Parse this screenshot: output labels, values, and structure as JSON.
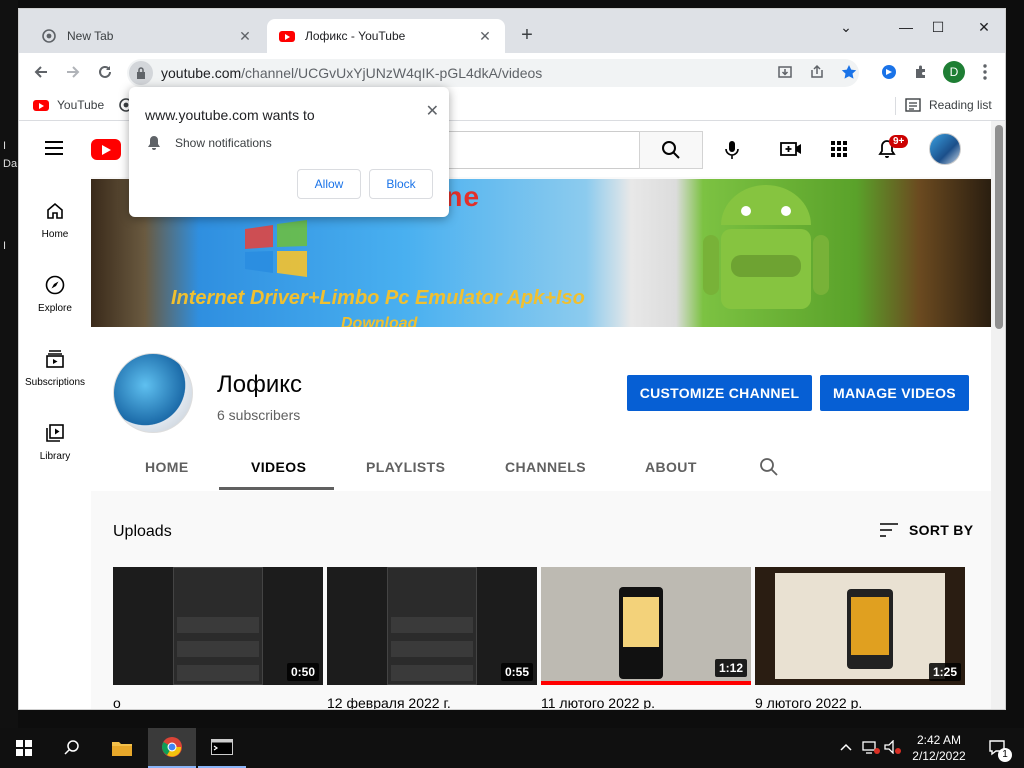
{
  "desktop": {
    "left_label_1": "I",
    "left_label_2": "Da",
    "left_label_3": "I"
  },
  "browser": {
    "tabs": [
      {
        "title": "New Tab",
        "close": "✕"
      },
      {
        "title": "Лофикс - YouTube",
        "close": "✕"
      }
    ],
    "new_tab": "+",
    "window_controls": {
      "tab_search": "⌄",
      "minimize": "—",
      "maximize": "☐",
      "close": "✕"
    },
    "url_host": "youtube.com",
    "url_path": "/channel/UCGvUxYjUNzW4qIK-pGL4dkA/videos",
    "profile_initial": "D",
    "bookmarks": [
      {
        "label": "YouTube"
      }
    ],
    "reading_list": "Reading list"
  },
  "popup": {
    "title": "www.youtube.com wants to",
    "permission": "Show notifications",
    "allow": "Allow",
    "block": "Block",
    "close": "✕"
  },
  "youtube": {
    "notification_badge": "9+",
    "nav": [
      {
        "label": "Home"
      },
      {
        "label": "Explore"
      },
      {
        "label": "Subscriptions"
      },
      {
        "label": "Library"
      }
    ],
    "banner": {
      "line1": "Machine",
      "line2": "Internet Driver+Limbo Pc Emulator Apk+Iso",
      "line3": "Download"
    },
    "channel": {
      "name": "Лофикс",
      "subscribers": "6 subscribers",
      "customize": "CUSTOMIZE CHANNEL",
      "manage": "MANAGE VIDEOS"
    },
    "channel_tabs": [
      "HOME",
      "VIDEOS",
      "PLAYLISTS",
      "CHANNELS",
      "ABOUT"
    ],
    "uploads_label": "Uploads",
    "sort_by": "SORT BY",
    "videos": [
      {
        "title": "о",
        "duration": "0:50"
      },
      {
        "title": "12 февраля 2022 г.",
        "duration": "0:55"
      },
      {
        "title": "11 лютого 2022 р.",
        "duration": "1:12"
      },
      {
        "title": "9 лютого 2022 р.",
        "duration": "1:25"
      }
    ]
  },
  "taskbar": {
    "time": "2:42 AM",
    "date": "2/12/2022",
    "notification_count": "1"
  }
}
